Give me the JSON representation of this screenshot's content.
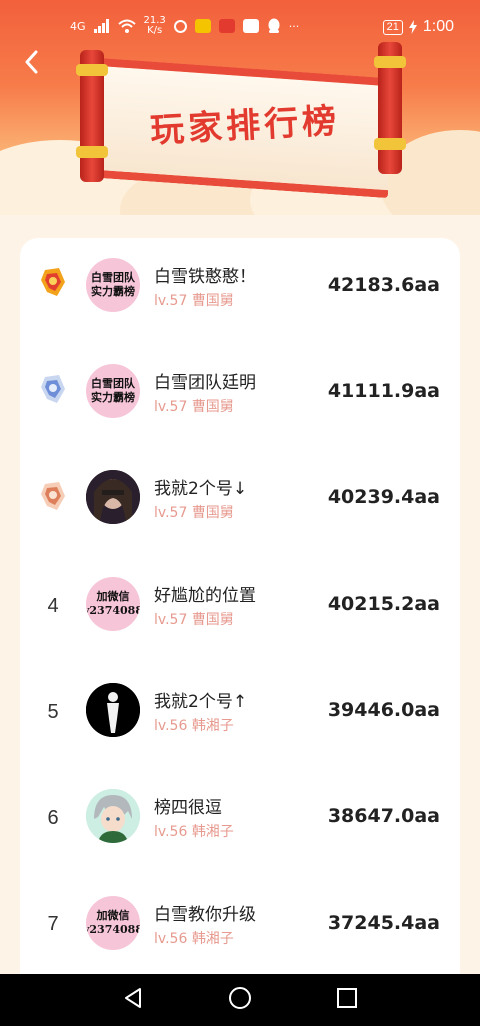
{
  "status_bar": {
    "network": "4G",
    "speed_value": "21.3",
    "speed_unit": "K/s",
    "battery": "21",
    "time": "1:00"
  },
  "header": {
    "title": "玩家排行榜"
  },
  "leaderboard": [
    {
      "rank": "1",
      "rank_badge": "gold-medal",
      "avatar_text": "白雪团队 实力霸榜",
      "avatar_style": "pink-text",
      "name": "白雪铁憨憨！",
      "level": "lv.57",
      "title": "曹国舅",
      "score": "42183.6aa"
    },
    {
      "rank": "2",
      "rank_badge": "silver-medal",
      "avatar_text": "白雪团队 实力霸榜",
      "avatar_style": "pink-text",
      "name": "白雪团队廷明",
      "level": "lv.57",
      "title": "曹国舅",
      "score": "41111.9aa"
    },
    {
      "rank": "3",
      "rank_badge": "bronze-medal",
      "avatar_text": "",
      "avatar_style": "photo",
      "name": "我就2个号↓",
      "level": "lv.57",
      "title": "曹国舅",
      "score": "40239.4aa"
    },
    {
      "rank": "4",
      "rank_badge": "",
      "avatar_text": "加微信 y2374088",
      "avatar_style": "pink-text",
      "name": "好尴尬的位置",
      "level": "lv.57",
      "title": "曹国舅",
      "score": "40215.2aa"
    },
    {
      "rank": "5",
      "rank_badge": "",
      "avatar_text": "",
      "avatar_style": "silhouette",
      "name": "我就2个号↑",
      "level": "lv.56",
      "title": "韩湘子",
      "score": "39446.0aa"
    },
    {
      "rank": "6",
      "rank_badge": "",
      "avatar_text": "",
      "avatar_style": "anime",
      "name": "榜四很逗",
      "level": "lv.56",
      "title": "韩湘子",
      "score": "38647.0aa"
    },
    {
      "rank": "7",
      "rank_badge": "",
      "avatar_text": "加微信 y2374088",
      "avatar_style": "pink-text",
      "name": "白雪教你升级",
      "level": "lv.56",
      "title": "韩湘子",
      "score": "37245.4aa"
    }
  ],
  "colors": {
    "header_red": "#f2603c",
    "scroll_red": "#e84b3a",
    "meta_pink": "#e79a8f",
    "page_bg": "#fdf3e6"
  },
  "icons": {
    "back": "chevron-left-icon",
    "nav_back": "triangle-back-icon",
    "nav_home": "circle-home-icon",
    "nav_recents": "square-recents-icon"
  }
}
